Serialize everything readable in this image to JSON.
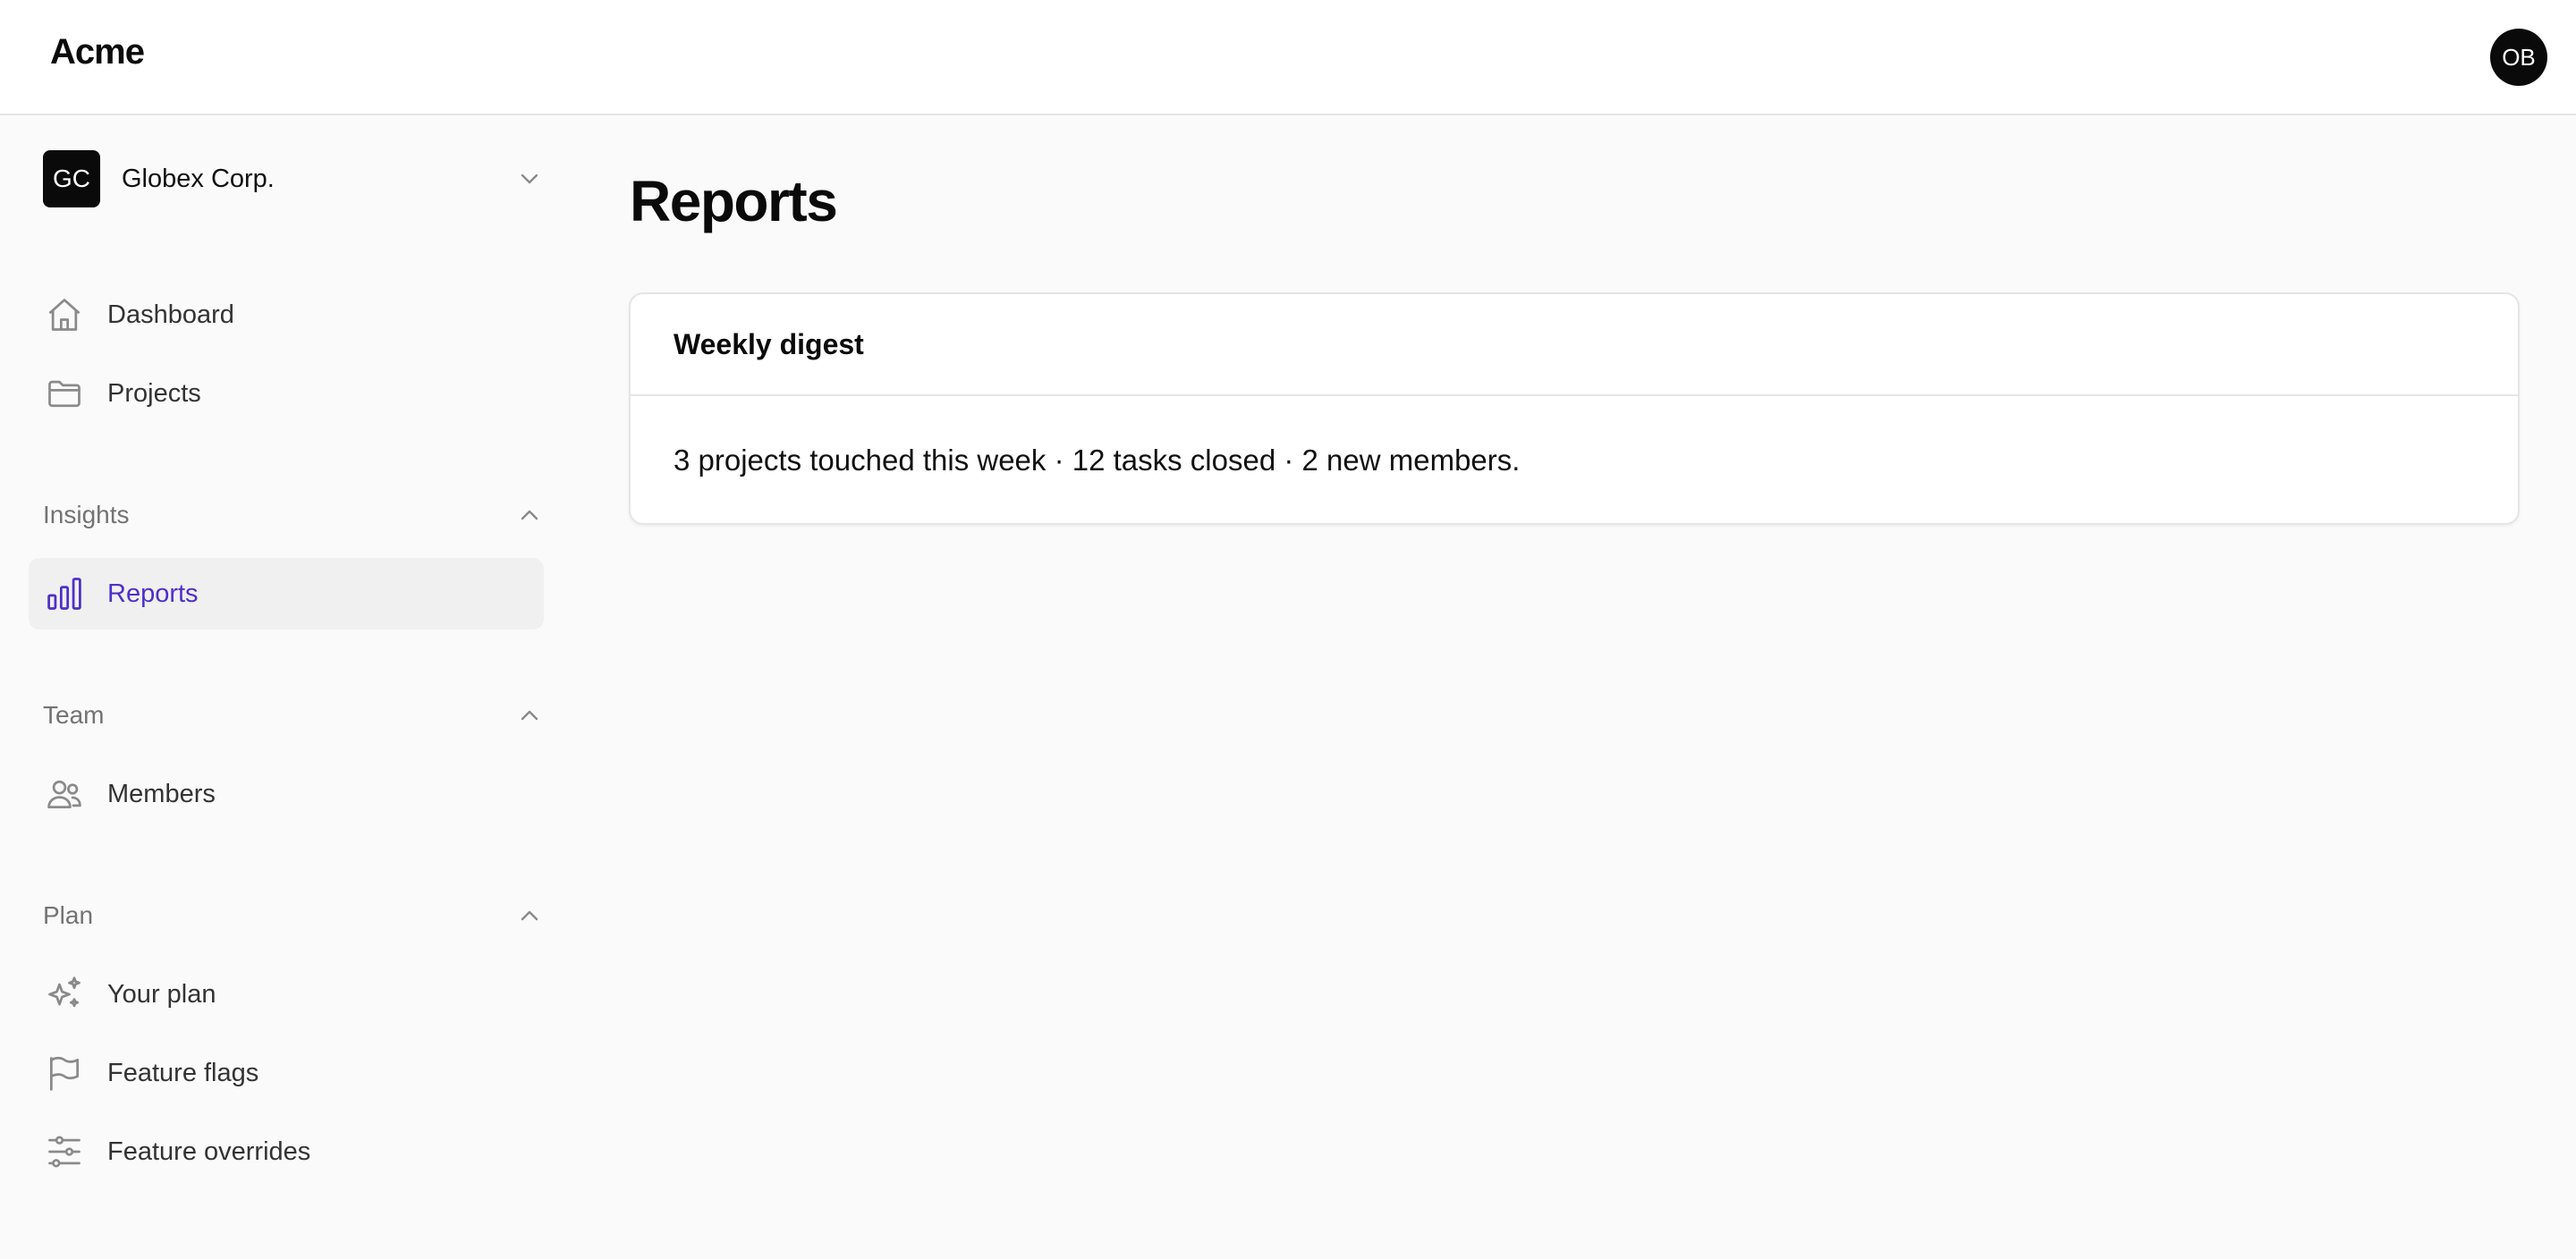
{
  "app": {
    "brand": "Acme",
    "user_initials": "OB"
  },
  "org": {
    "initials": "GC",
    "name": "Globex Corp."
  },
  "sidebar": {
    "top_items": [
      {
        "label": "Dashboard",
        "icon": "home-icon"
      },
      {
        "label": "Projects",
        "icon": "folder-icon"
      }
    ],
    "sections": [
      {
        "label": "Insights",
        "items": [
          {
            "label": "Reports",
            "icon": "bar-chart-icon",
            "active": true
          }
        ]
      },
      {
        "label": "Team",
        "items": [
          {
            "label": "Members",
            "icon": "users-icon"
          }
        ]
      },
      {
        "label": "Plan",
        "items": [
          {
            "label": "Your plan",
            "icon": "sparkles-icon"
          },
          {
            "label": "Feature flags",
            "icon": "flag-icon"
          },
          {
            "label": "Feature overrides",
            "icon": "sliders-icon"
          }
        ]
      }
    ]
  },
  "main": {
    "title": "Reports",
    "card": {
      "title": "Weekly digest",
      "body": "3 projects touched this week · 12 tasks closed · 2 new members."
    }
  },
  "colors": {
    "accent": "#4f2fc9",
    "muted": "#737373",
    "badge_bg": "#0a0a0a"
  }
}
